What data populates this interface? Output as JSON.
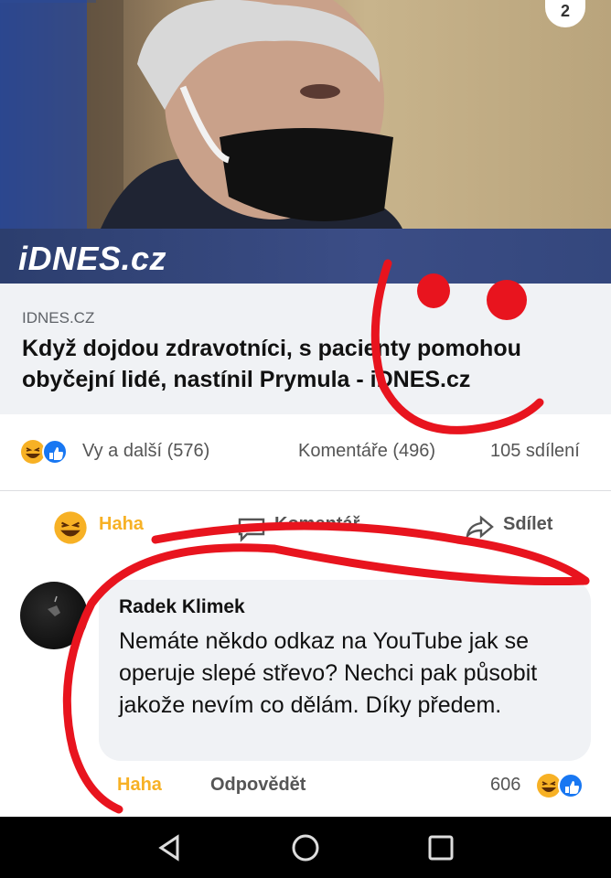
{
  "header": {
    "brand": "iDNES.cz",
    "badge": "2"
  },
  "link_preview": {
    "domain": "IDNES.CZ",
    "title": "Když dojdou zdravotníci, s pacienty pomohou obyčejní lidé, nastínil Prymula - iDNES.cz"
  },
  "stats": {
    "reactions_text": "Vy a další (576)",
    "comments_text": "Komentáře (496)",
    "shares_text": "105 sdílení"
  },
  "actions": {
    "haha": "Haha",
    "comment": "Komentář",
    "share": "Sdílet"
  },
  "comment": {
    "author": "Radek Klimek",
    "text": "Nemáte někdo odkaz na YouTube jak se operuje slepé střevo? Nechci pak působit jakože nevím co dělám. Díky předem.",
    "reaction_label": "Haha",
    "reply_label": "Odpovědět",
    "reaction_count": "606"
  },
  "colors": {
    "facebook_blue": "#1877f2",
    "haha_orange": "#f7b125",
    "marker_red": "#e8141e"
  },
  "navbar": {
    "icons": [
      "back-icon",
      "home-icon",
      "recents-icon"
    ]
  }
}
